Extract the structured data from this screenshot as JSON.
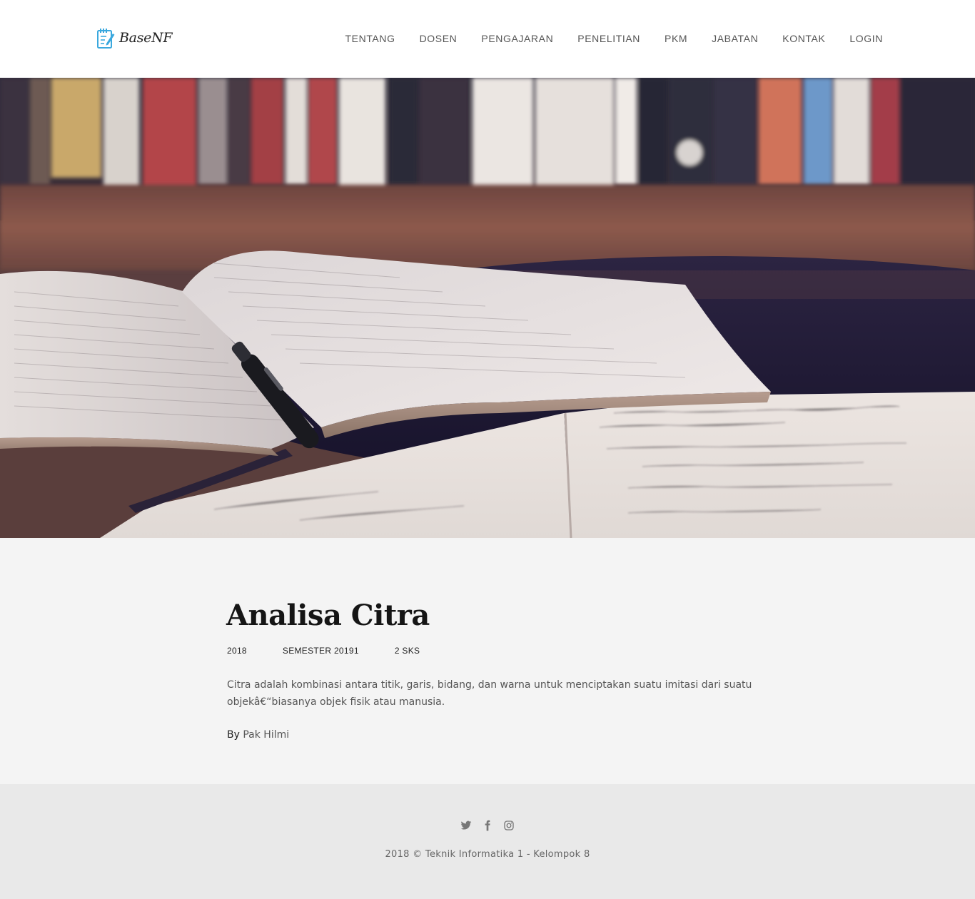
{
  "brand": {
    "name": "BaseNF",
    "logo_icon": "notepad-pencil-icon",
    "accent": "#3aa8de"
  },
  "nav": {
    "items": [
      {
        "label": "TENTANG"
      },
      {
        "label": "DOSEN"
      },
      {
        "label": "PENGAJARAN"
      },
      {
        "label": "PENELITIAN"
      },
      {
        "label": "PKM"
      },
      {
        "label": "JABATAN"
      },
      {
        "label": "KONTAK"
      },
      {
        "label": "LOGIN"
      }
    ]
  },
  "hero": {
    "image": "open-books-photo"
  },
  "course": {
    "title": "Analisa Citra",
    "year": "2018",
    "semester": "SEMESTER 20191",
    "credits": "2 SKS",
    "description": "Citra adalah kombinasi antara titik, garis, bidang, dan warna untuk menciptakan suatu imitasi dari suatu objekâ€“biasanya objek fisik atau manusia.",
    "author_prefix": "By",
    "author": "Pak Hilmi"
  },
  "footer": {
    "social": [
      {
        "icon": "twitter-icon"
      },
      {
        "icon": "facebook-icon"
      },
      {
        "icon": "instagram-icon"
      }
    ],
    "copyright": "2018 © Teknik Informatika 1 - Kelompok 8"
  }
}
